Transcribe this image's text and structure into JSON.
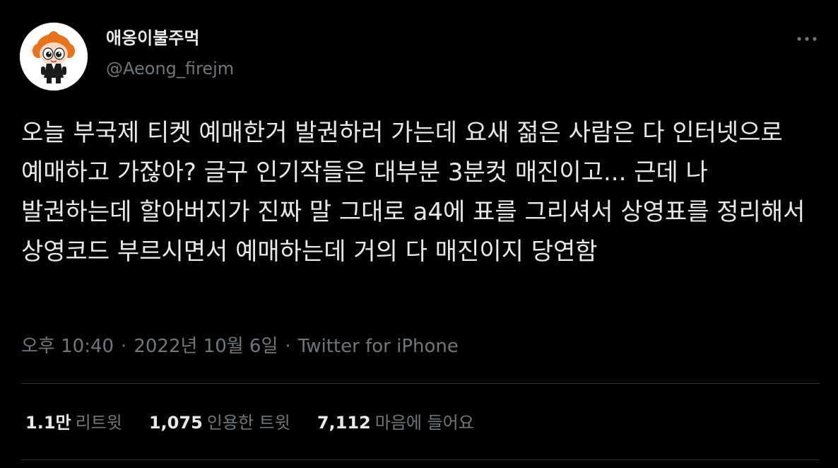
{
  "user": {
    "display_name": "애옹이불주먹",
    "handle": "@Aeong_firejm"
  },
  "tweet": {
    "text": "오늘 부국제 티켓 예매한거 발권하러 가는데 요새 젊은 사람은 다 인터넷으로 예매하고 가잖아? 글구 인기작들은 대부분 3분컷 매진이고... 근데 나 발권하는데 할아버지가 진짜 말 그대로 a4에 표를 그리셔서 상영표를 정리해서 상영코드 부르시면서 예매하는데 거의 다 매진이지 당연함"
  },
  "meta": {
    "time": "오후 10:40",
    "separator": "·",
    "date": "2022년 10월 6일",
    "source": "Twitter for iPhone"
  },
  "stats": {
    "retweets": {
      "value": "1.1만",
      "label": "리트윗"
    },
    "quotes": {
      "value": "1,075",
      "label": "인용한 트윗"
    },
    "likes": {
      "value": "7,112",
      "label": "마음에 들어요"
    }
  },
  "icons": {
    "more": "more-horizontal-icon",
    "avatar": "powerpuff-avatar-image"
  },
  "colors": {
    "background": "#000000",
    "text_primary": "#e7e9ea",
    "text_secondary": "#71767b",
    "divider": "#2f3336"
  }
}
